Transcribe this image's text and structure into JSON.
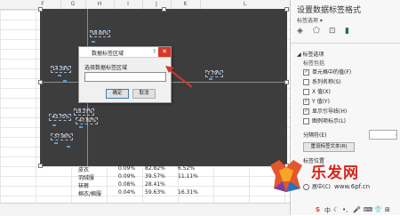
{
  "columns": [
    "F",
    "G",
    "H",
    "I",
    "J",
    "K",
    "L"
  ],
  "chart": {
    "labels": [
      {
        "text": "58.66%"
      },
      {
        "text": "14.29%"
      },
      {
        "text": "7.79%"
      },
      {
        "text": "18.27%"
      },
      {
        "text": "-43.75%"
      },
      {
        "text": "-47.82%"
      },
      {
        "text": "-37.96%"
      }
    ]
  },
  "dialog": {
    "title": "数据标签区域",
    "help": "?",
    "close": "✕",
    "prompt": "选择数据标签区域",
    "input_value": "",
    "collapse_icon": "⬆",
    "ok_label": "确定",
    "cancel_label": "取消"
  },
  "table_rows": [
    {
      "name": "皮衣",
      "a": "0.09%",
      "b": "82.82%",
      "c": "6.52%"
    },
    {
      "name": "羽绒服",
      "a": "0.09%",
      "b": "39.57%",
      "c": "11.11%"
    },
    {
      "name": "袜裤",
      "a": "0.08%",
      "b": "28.41%",
      "c": ""
    },
    {
      "name": "棉衣/棉服",
      "a": "0.04%",
      "b": "59.63%",
      "c": "16.31%"
    }
  ],
  "pane": {
    "title": "设置数据标签格式",
    "subtitle": "标签选项 ▾",
    "section": "◢ 标签选项",
    "subsection": "标签包括",
    "options": [
      {
        "label": "单元格中的值(F)",
        "checked": true
      },
      {
        "label": "系列名称(S)",
        "checked": false
      },
      {
        "label": "X 值(X)",
        "checked": false
      },
      {
        "label": "Y 值(Y)",
        "checked": true
      },
      {
        "label": "显示引导线(H)",
        "checked": true
      },
      {
        "label": "图例项标示(L)",
        "checked": false
      }
    ],
    "separator_label": "分隔符(E)",
    "separator_value": ",",
    "reset_label": "重设标签文本(R)",
    "position_label": "标签位置",
    "radio_label": "居中(C)"
  },
  "tray": {
    "s": "S",
    "zh": "中",
    "moon": "☾",
    "dots": "•,",
    "mic": "🎤",
    "kbd": "⌨",
    "shirt": "👕",
    "grid": "⊞"
  },
  "watermark": {
    "brand": "乐发网",
    "url": "www.6pf.cn"
  },
  "colors": {
    "chart_bg": "#3d3d3d",
    "dialog_close": "#d9362b",
    "arrow": "#d9362b",
    "label_series": "#5b9bd5"
  }
}
